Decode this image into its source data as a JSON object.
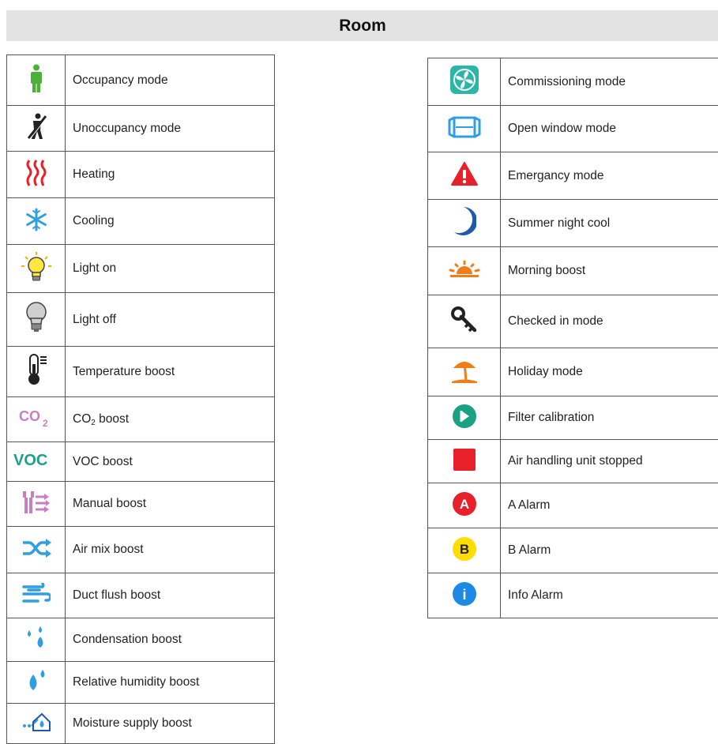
{
  "header": {
    "title": "Room"
  },
  "left_table": [
    {
      "icon": "person-green-icon",
      "label": "Occupancy mode"
    },
    {
      "icon": "person-crossed-icon",
      "label": "Unoccupancy mode"
    },
    {
      "icon": "heat-waves-icon",
      "label": "Heating"
    },
    {
      "icon": "snowflake-icon",
      "label": "Cooling"
    },
    {
      "icon": "lightbulb-on-icon",
      "label": "Light on"
    },
    {
      "icon": "lightbulb-off-icon",
      "label": "Light off"
    },
    {
      "icon": "thermometer-icon",
      "label": "Temperature boost"
    },
    {
      "icon": "co2-icon",
      "label_main": "CO",
      "label_sub": "2",
      "label_rest": " boost",
      "icon_text": "CO",
      "icon_sub": "2"
    },
    {
      "icon": "voc-icon",
      "label": "VOC boost",
      "icon_text": "VOC"
    },
    {
      "icon": "manual-boost-icon",
      "label": "Manual boost"
    },
    {
      "icon": "air-mix-icon",
      "label": "Air mix boost"
    },
    {
      "icon": "duct-flush-icon",
      "label": "Duct flush boost"
    },
    {
      "icon": "condensation-drops-icon",
      "label": "Condensation boost"
    },
    {
      "icon": "humidity-drops-icon",
      "label": "Relative humidity boost"
    },
    {
      "icon": "moisture-house-icon",
      "label": "Moisture supply boost"
    }
  ],
  "right_table": [
    {
      "icon": "fan-icon",
      "label": "Commissioning mode"
    },
    {
      "icon": "open-window-icon",
      "label": "Open window mode"
    },
    {
      "icon": "warning-triangle-icon",
      "label": "Emergancy mode"
    },
    {
      "icon": "moon-icon",
      "label": "Summer night cool"
    },
    {
      "icon": "sunrise-icon",
      "label": "Morning boost"
    },
    {
      "icon": "key-icon",
      "label": "Checked in mode"
    },
    {
      "icon": "beach-umbrella-icon",
      "label": "Holiday mode"
    },
    {
      "icon": "filter-icon",
      "label": "Filter calibration"
    },
    {
      "icon": "stop-square-icon",
      "label": "Air handling unit stopped"
    },
    {
      "icon": "alarm-a-icon",
      "label": "A Alarm",
      "icon_text": "A"
    },
    {
      "icon": "alarm-b-icon",
      "label": "B Alarm",
      "icon_text": "B"
    },
    {
      "icon": "info-alarm-icon",
      "label": "Info Alarm",
      "icon_text": "i"
    }
  ],
  "colors": {
    "green": "#4caf37",
    "red": "#e8202a",
    "blue": "#2f9fe0",
    "dark_blue": "#1e5aa8",
    "teal": "#2bb7a8",
    "orange": "#f07d1a",
    "pink": "#c77fc0",
    "yellow": "#ffdd00",
    "voc_green": "#1aa08c"
  }
}
